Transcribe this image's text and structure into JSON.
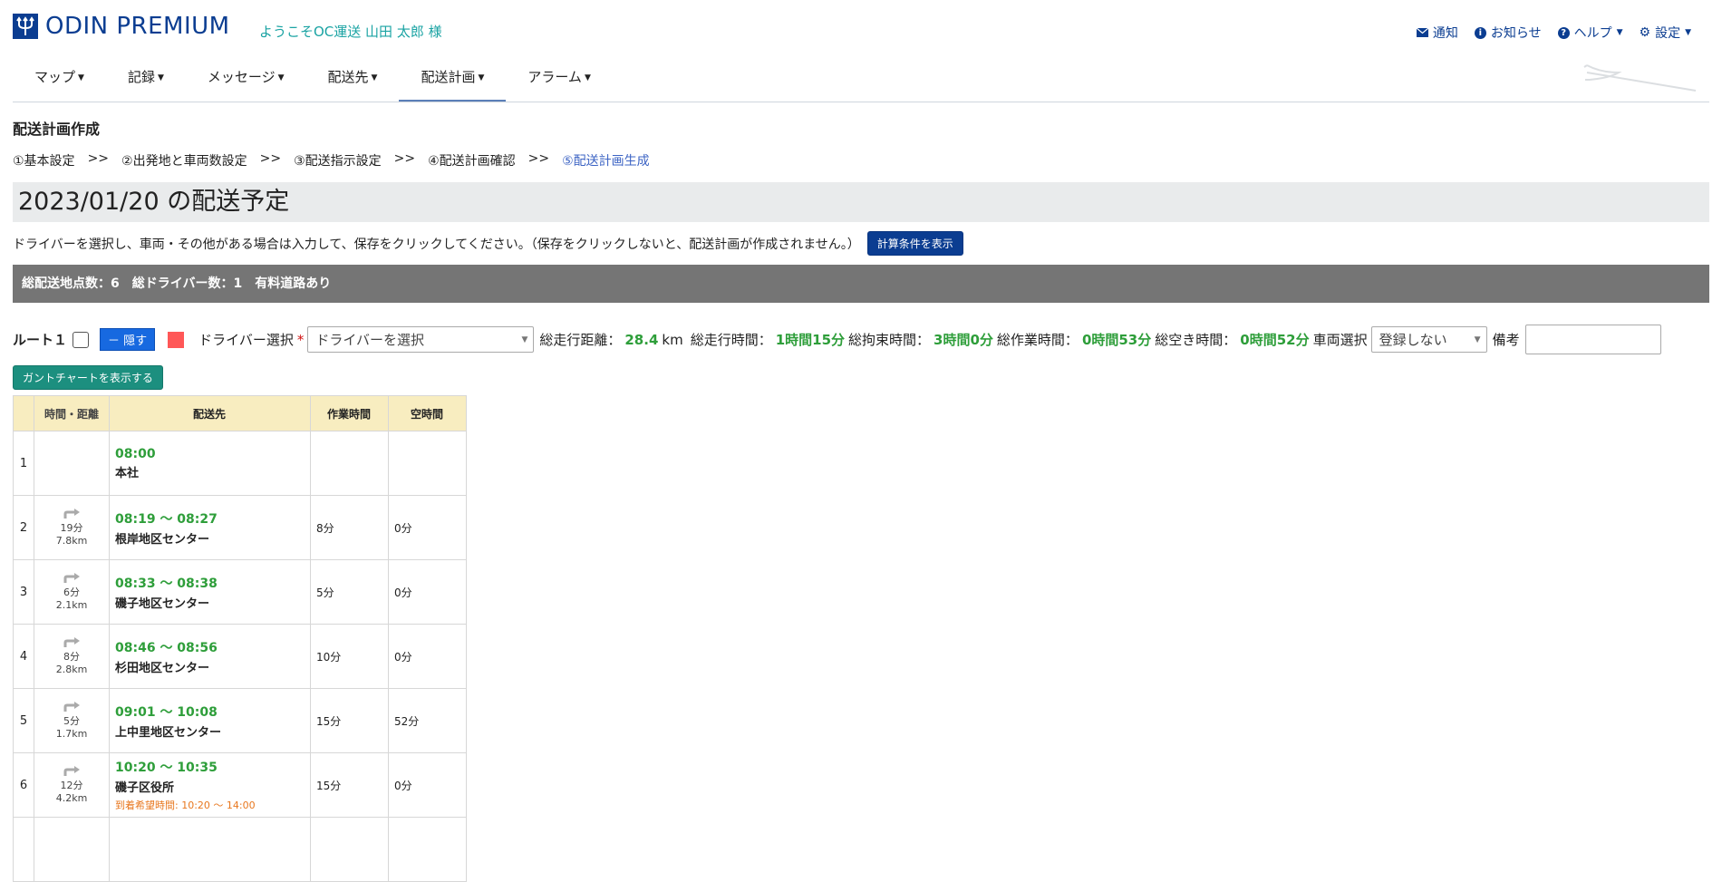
{
  "header": {
    "logo_text": "ODIN PREMIUM",
    "welcome": "ようこそOC運送 山田 太郎 様",
    "links": [
      {
        "label": "通知",
        "icon": "mail-icon"
      },
      {
        "label": "お知らせ",
        "icon": "info-icon"
      },
      {
        "label": "ヘルプ",
        "icon": "help-icon"
      },
      {
        "label": "設定",
        "icon": "gear-icon"
      }
    ]
  },
  "nav": {
    "items": [
      {
        "label": "マップ"
      },
      {
        "label": "記録"
      },
      {
        "label": "メッセージ"
      },
      {
        "label": "配送先"
      },
      {
        "label": "配送計画"
      },
      {
        "label": "アラーム"
      }
    ]
  },
  "section": {
    "title": "配送計画作成",
    "steps": [
      "①基本設定",
      "②出発地と車両数設定",
      "③配送指示設定",
      "④配送計画確認",
      "⑤配送計画生成"
    ],
    "step_sep": ">>"
  },
  "plan": {
    "date_heading": "2023/01/20 の配送予定",
    "instruction": "ドライバーを選択し、車両・その他がある場合は入力して、保存をクリックしてください。（保存をクリックしないと、配送計画が作成されません。）",
    "calc_button": "計算条件を表示",
    "summary": "総配送地点数：6　総ドライバー数：1　有料道路あり"
  },
  "route": {
    "label": "ルート１",
    "hide_button": "－ 隠す",
    "color": "#ff5757",
    "driver_label": "ドライバー選択",
    "required_mark": "*",
    "driver_select": "ドライバーを選択",
    "total_distance_label": "総走行距離：",
    "total_distance_value": "28.4",
    "total_distance_unit": "km",
    "total_drive_label": "総走行時間：",
    "total_drive_value": "1時間15分",
    "total_bound_label": "総拘束時間：",
    "total_bound_value": "3時間0分",
    "total_work_label": "総作業時間：",
    "total_work_value": "0時間53分",
    "total_idle_label": "総空き時間：",
    "total_idle_value": "0時間52分",
    "vehicle_label": "車両選択",
    "vehicle_select": "登録しない",
    "notes_label": "備考",
    "gantt_button": "ガントチャートを表示する"
  },
  "table": {
    "headers": [
      "",
      "時間・距離",
      "配送先",
      "作業時間",
      "空時間"
    ],
    "rows": [
      {
        "no": "1",
        "dur": "",
        "dist": "",
        "time": "08:00",
        "dest": "本社",
        "work": "",
        "idle": "",
        "hope": ""
      },
      {
        "no": "2",
        "dur": "19分",
        "dist": "7.8km",
        "time": "08:19 ～ 08:27",
        "dest": "根岸地区センター",
        "work": "8分",
        "idle": "0分",
        "hope": ""
      },
      {
        "no": "3",
        "dur": "6分",
        "dist": "2.1km",
        "time": "08:33 ～ 08:38",
        "dest": "磯子地区センター",
        "work": "5分",
        "idle": "0分",
        "hope": ""
      },
      {
        "no": "4",
        "dur": "8分",
        "dist": "2.8km",
        "time": "08:46 ～ 08:56",
        "dest": "杉田地区センター",
        "work": "10分",
        "idle": "0分",
        "hope": ""
      },
      {
        "no": "5",
        "dur": "5分",
        "dist": "1.7km",
        "time": "09:01 ～ 10:08",
        "dest": "上中里地区センター",
        "work": "15分",
        "idle": "52分",
        "hope": ""
      },
      {
        "no": "6",
        "dur": "12分",
        "dist": "4.2km",
        "time": "10:20 ～ 10:35",
        "dest": "磯子区役所",
        "work": "15分",
        "idle": "0分",
        "hope": "到着希望時間: 10:20 ～ 14:00"
      }
    ]
  }
}
